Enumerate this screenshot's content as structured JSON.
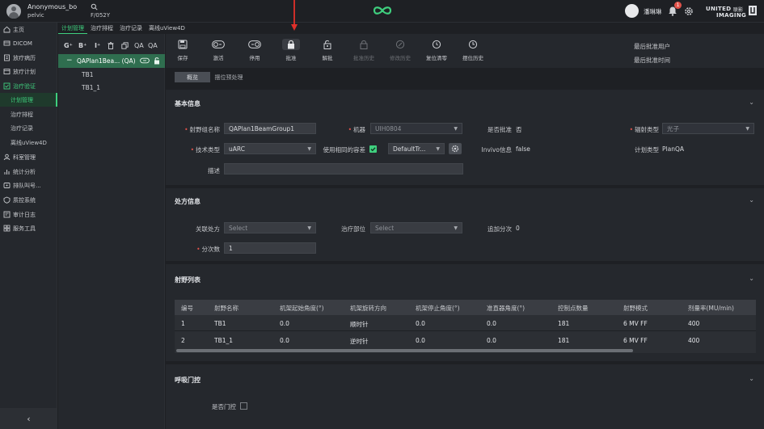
{
  "header": {
    "user_name": "Anonymous_bo",
    "user_sub": "pelvic",
    "patient_id": "F/052Y",
    "operator": "潘琳琳",
    "notif_count": "1",
    "brand_line1": "UNITED",
    "brand_cn": "联影",
    "brand_line2": "IMAGING",
    "colors": {
      "accent": "#3fcf7e",
      "alert": "#e0524a"
    }
  },
  "sidebar": {
    "items": [
      {
        "label": "主页",
        "icon": "home-icon"
      },
      {
        "label": "DICOM",
        "icon": "dicom-icon"
      },
      {
        "label": "放疗病历",
        "icon": "record-icon"
      },
      {
        "label": "放疗计划",
        "icon": "plan-icon"
      },
      {
        "label": "治疗验证",
        "icon": "verify-icon"
      },
      {
        "label": "计划管理",
        "icon": ""
      },
      {
        "label": "治疗排程",
        "icon": ""
      },
      {
        "label": "治疗记录",
        "icon": ""
      },
      {
        "label": "离线uView4D",
        "icon": ""
      },
      {
        "label": "科室管理",
        "icon": "dept-icon"
      },
      {
        "label": "统计分析",
        "icon": "stats-icon"
      },
      {
        "label": "排队叫号...",
        "icon": "queue-icon"
      },
      {
        "label": "质控系统",
        "icon": "qc-icon"
      },
      {
        "label": "审计日志",
        "icon": "audit-icon"
      },
      {
        "label": "服务工具",
        "icon": "tool-icon"
      }
    ],
    "collapse": "‹"
  },
  "tabs": [
    "计划管理",
    "治疗排程",
    "治疗记录",
    "离线uView4D"
  ],
  "tree": {
    "toolbar": [
      "G⁺",
      "B⁺",
      "I⁺",
      "🗑",
      "⧉",
      "QA",
      "QA"
    ],
    "root": "QAPlan1Bea... (QA)",
    "children": [
      "TB1",
      "TB1_1"
    ]
  },
  "toolbar": {
    "tools": [
      "保存",
      "激活",
      "停用",
      "批准",
      "解批",
      "批准历史",
      "修改历史",
      "复位清零",
      "摆位历史"
    ],
    "last_approver_label": "最后批准用户",
    "last_approve_time_label": "最后批准时间"
  },
  "subtabs": [
    "概览",
    "摆位预处理"
  ],
  "basic": {
    "title": "基本信息",
    "beam_group_label": "射野组名称",
    "beam_group_value": "QAPlan1BeamGroup1",
    "machine_label": "机器",
    "machine_value": "UIH0804",
    "approved_label": "是否批准",
    "approved_value": "否",
    "radiation_label": "辐射类型",
    "radiation_value": "光子",
    "technique_label": "技术类型",
    "technique_value": "uARC",
    "same_tol_label": "使用相同的容差",
    "tolerance_value": "DefaultTr...",
    "invivo_label": "Invivo信息",
    "invivo_value": "false",
    "plan_type_label": "计划类型",
    "plan_type_value": "PlanQA",
    "desc_label": "描述"
  },
  "rx": {
    "title": "处方信息",
    "link_label": "关联处方",
    "link_placeholder": "Select",
    "site_label": "治疗部位",
    "site_placeholder": "Select",
    "extra_label": "追加分次",
    "extra_value": "0",
    "fractions_label": "分次数",
    "fractions_value": "1"
  },
  "beams": {
    "title": "射野列表",
    "headers": [
      "编号",
      "射野名称",
      "机架起始角度(°)",
      "机架旋转方向",
      "机架停止角度(°)",
      "准直器角度(°)",
      "控制点数量",
      "射野模式",
      "剂量率(MU/min)"
    ],
    "rows": [
      [
        "1",
        "TB1",
        "0.0",
        "顺时针",
        "0.0",
        "0.0",
        "181",
        "6 MV FF",
        "400"
      ],
      [
        "2",
        "TB1_1",
        "0.0",
        "逆时针",
        "0.0",
        "0.0",
        "181",
        "6 MV FF",
        "400"
      ]
    ]
  },
  "gating": {
    "title": "呼吸门控",
    "gating_label": "是否门控"
  }
}
